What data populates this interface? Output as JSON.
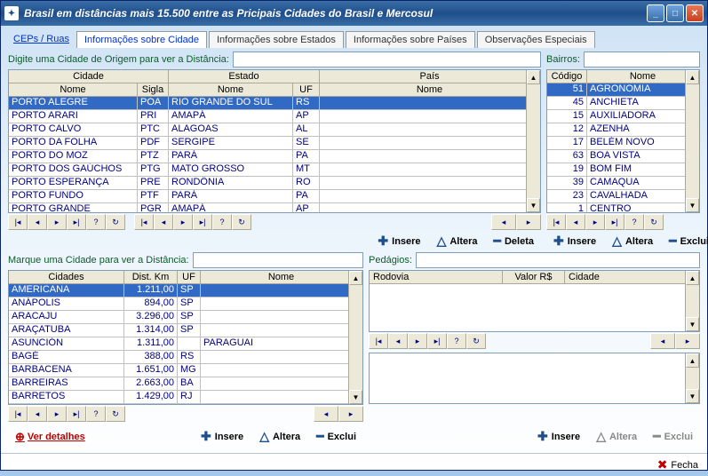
{
  "title": "Brasil em  distâncias mais 15.500 entre as Pricipais Cidades do Brasil e Mercosul",
  "tabs": {
    "t0": "CEPs / Ruas",
    "t1": "Informações sobre Cidade",
    "t2": "Informações sobre Estados",
    "t3": "Informações sobre Países",
    "t4": "Observações Especiais"
  },
  "labels": {
    "origem": "Digite uma Cidade de Origem para ver a Distância:",
    "bairros": "Bairros:",
    "marque": "Marque uma Cidade para ver a Distância:",
    "pedagios": "Pedágios:",
    "insere": "Insere",
    "altera": "Altera",
    "deleta": "Deleta",
    "exclui": "Exclui",
    "verdet": "Ver detalhes",
    "fecha": "Fecha"
  },
  "grid1": {
    "group_cidade": "Cidade",
    "group_estado": "Estado",
    "group_pais": "País",
    "h_nome": "Nome",
    "h_sigla": "Sigla",
    "h_nome2": "Nome",
    "h_uf": "UF",
    "h_nome3": "Nome",
    "rows": [
      {
        "cid": "PORTO ALEGRE",
        "sig": "POA",
        "est": "RIO GRANDE DO SUL",
        "uf": "RS",
        "pais": ""
      },
      {
        "cid": "PORTO ARARI",
        "sig": "PRI",
        "est": "AMAPÁ",
        "uf": "AP",
        "pais": ""
      },
      {
        "cid": "PORTO CALVO",
        "sig": "PTC",
        "est": "ALAGOAS",
        "uf": "AL",
        "pais": ""
      },
      {
        "cid": "PORTO DA FOLHA",
        "sig": "PDF",
        "est": "SERGIPE",
        "uf": "SE",
        "pais": ""
      },
      {
        "cid": "PORTO DO MOZ",
        "sig": "PTZ",
        "est": "PARÁ",
        "uf": "PA",
        "pais": ""
      },
      {
        "cid": "PORTO DOS GAÚCHOS",
        "sig": "PTG",
        "est": "MATO GROSSO",
        "uf": "MT",
        "pais": ""
      },
      {
        "cid": "PORTO ESPERANÇA",
        "sig": "PRE",
        "est": "RONDÔNIA",
        "uf": "RO",
        "pais": ""
      },
      {
        "cid": "PORTO FUNDO",
        "sig": "PTF",
        "est": "PARÁ",
        "uf": "PA",
        "pais": ""
      },
      {
        "cid": "PORTO GRANDE",
        "sig": "PGR",
        "est": "AMAPÁ",
        "uf": "AP",
        "pais": ""
      }
    ]
  },
  "grid2": {
    "h_cod": "Código",
    "h_nome": "Nome",
    "rows": [
      {
        "cod": "51",
        "nome": "AGRONOMIA"
      },
      {
        "cod": "45",
        "nome": "ANCHIETA"
      },
      {
        "cod": "15",
        "nome": "AUXILIADORA"
      },
      {
        "cod": "12",
        "nome": "AZENHA"
      },
      {
        "cod": "17",
        "nome": "BELÉM NOVO"
      },
      {
        "cod": "63",
        "nome": "BOA VISTA"
      },
      {
        "cod": "19",
        "nome": "BOM FIM"
      },
      {
        "cod": "39",
        "nome": "CAMAQUA"
      },
      {
        "cod": "23",
        "nome": "CAVALHADA"
      },
      {
        "cod": "1",
        "nome": "CENTRO"
      }
    ]
  },
  "grid3": {
    "h_cid": "Cidades",
    "h_dist": "Dist. Km",
    "h_uf": "UF",
    "h_nome": "Nome",
    "rows": [
      {
        "cid": "AMERICANA",
        "km": "1.211,00",
        "uf": "SP",
        "n": ""
      },
      {
        "cid": "ANÁPOLIS",
        "km": "894,00",
        "uf": "SP",
        "n": ""
      },
      {
        "cid": "ARACAJU",
        "km": "3.296,00",
        "uf": "SP",
        "n": ""
      },
      {
        "cid": "ARAÇATUBA",
        "km": "1.314,00",
        "uf": "SP",
        "n": ""
      },
      {
        "cid": "ASUNCIÓN",
        "km": "1.311,00",
        "uf": "",
        "n": "PARAGUAI"
      },
      {
        "cid": "BAGÉ",
        "km": "388,00",
        "uf": "RS",
        "n": ""
      },
      {
        "cid": "BARBACENA",
        "km": "1.651,00",
        "uf": "MG",
        "n": ""
      },
      {
        "cid": "BARREIRAS",
        "km": "2.663,00",
        "uf": "BA",
        "n": ""
      },
      {
        "cid": "BARRETOS",
        "km": "1.429,00",
        "uf": "RJ",
        "n": ""
      }
    ]
  },
  "grid4": {
    "h_rod": "Rodovia",
    "h_val": "Valor R$",
    "h_cid": "Cidade"
  }
}
